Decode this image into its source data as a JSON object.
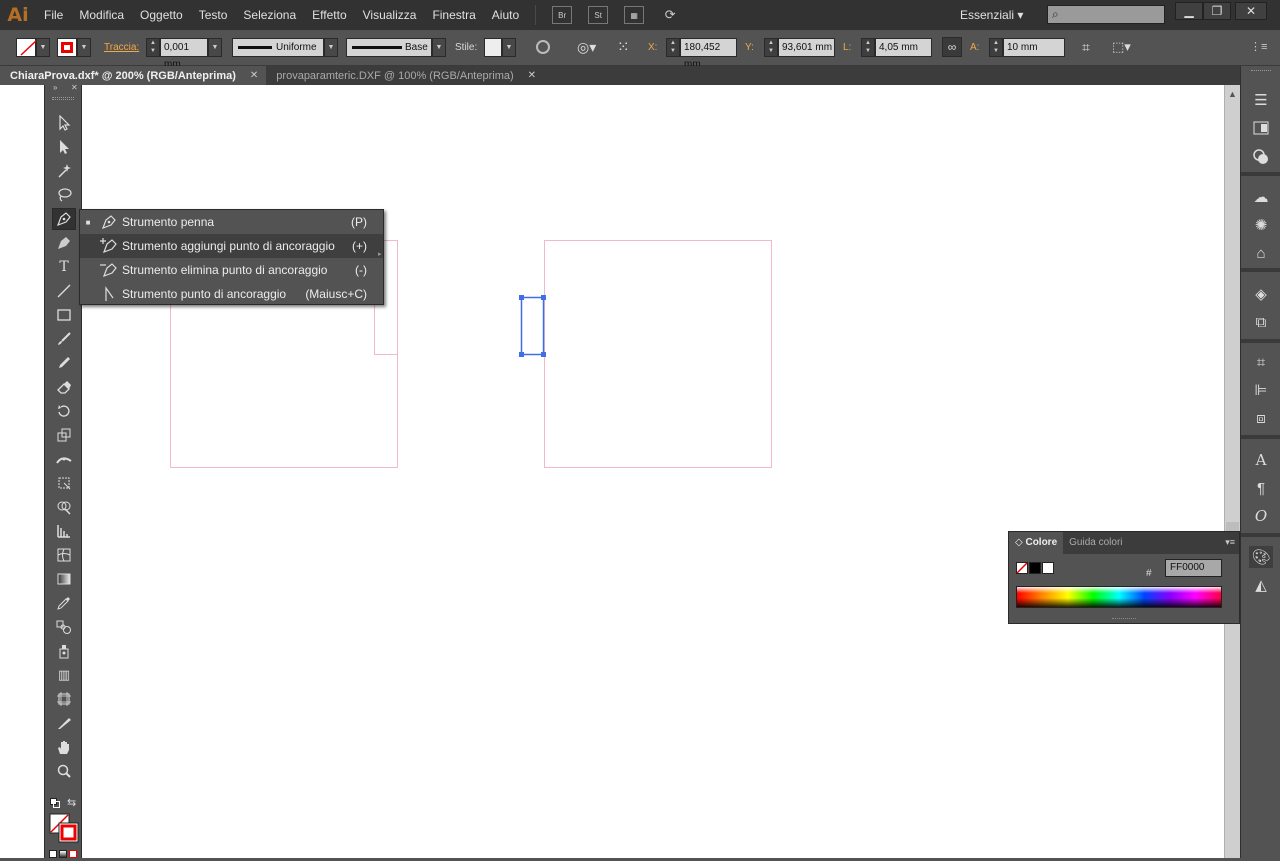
{
  "app": {
    "logo": "Ai",
    "workspace": "Essenziali ▾"
  },
  "menu": [
    "File",
    "Modifica",
    "Oggetto",
    "Testo",
    "Seleziona",
    "Effetto",
    "Visualizza",
    "Finestra",
    "Aiuto"
  ],
  "menubar_buttons": {
    "bridge": "Br",
    "stock": "St"
  },
  "window_buttons": {
    "minimize": "▁",
    "restore": "❐",
    "close": "✕"
  },
  "control": {
    "stroke_label": "Traccia:",
    "stroke_weight": "0,001 mm",
    "profile": "Uniforme",
    "brush": "Base",
    "style_label": "Stile:",
    "x_label": "X:",
    "x_value": "180,452 mm",
    "y_label": "Y:",
    "y_value": "93,601 mm",
    "w_label": "L:",
    "w_value": "4,05 mm",
    "h_label": "A:",
    "h_value": "10 mm"
  },
  "tabs": [
    {
      "label": "ChiaraProva.dxf* @ 200% (RGB/Anteprima)",
      "close": "✕",
      "active": true
    },
    {
      "label": "provaparamteric.DXF @ 100% (RGB/Anteprima)",
      "close": "✕",
      "active": false
    }
  ],
  "flyout": [
    {
      "label": "Strumento penna",
      "shortcut": "(P)",
      "bullet": "■"
    },
    {
      "label": "Strumento aggiungi punto di ancoraggio",
      "shortcut": "(+)",
      "bullet": ""
    },
    {
      "label": "Strumento elimina punto di ancoraggio",
      "shortcut": "(-)",
      "bullet": ""
    },
    {
      "label": "Strumento punto di ancoraggio",
      "shortcut": "(Maiusc+C)",
      "bullet": ""
    }
  ],
  "tools": {
    "type_glyph": "T",
    "graph_glyph": "▥"
  },
  "color_panel": {
    "tabs": [
      "Colore",
      "Guida colori"
    ],
    "hex_label": "#",
    "hex_value": "FF0000",
    "menu": "▾≡"
  },
  "colors": {
    "accent_orange": "#b56f24",
    "artboard_line": "#f0b8c8",
    "selection_blue": "#3f6fe0",
    "canvas_bg": "#ffffff",
    "ui_dark": "#323232"
  },
  "dock_glyphs": {
    "character": "A",
    "paragraph": "¶",
    "opentype": "O"
  }
}
